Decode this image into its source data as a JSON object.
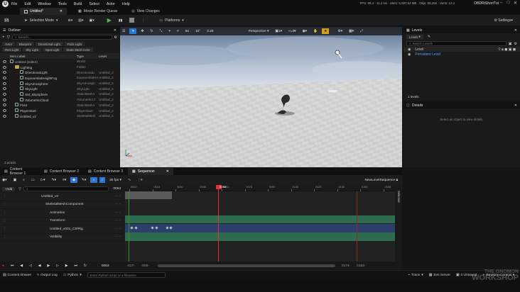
{
  "menubar": {
    "logo": "U",
    "items": [
      "File",
      "Edit",
      "Window",
      "Tools",
      "Build",
      "Select",
      "Actor",
      "Help"
    ],
    "stats": "FPS: 89.4  ·  11.2 ms  ·  Mem: 5,587.64 MB  ·  Objs: 58,255  ·  Verts: 13.4",
    "project": "OBDRtShortTut"
  },
  "tabs": {
    "level_tab": "Untitled*",
    "movie_render_queue": "Movie Render Queue",
    "view_changes": "View Changes"
  },
  "toolbar": {
    "selection_mode": "Selection Mode",
    "platforms": "Platforms"
  },
  "outliner": {
    "title": "Outliner",
    "search_placeholder": "Search...",
    "filters_row1": [
      "Actor",
      "Blueprint",
      "Directional Light",
      "Point Light"
    ],
    "filters_row2": [
      "Rect Light",
      "Sky Light",
      "Spot Light",
      "Static Mesh Actor"
    ],
    "col_item": "Item Label",
    "col_type": "Type",
    "col_level": "Level",
    "rows": [
      {
        "name": "Untitled (Editor)",
        "type": "World",
        "level": "",
        "indent": 0,
        "icon": "world"
      },
      {
        "name": "Lighting",
        "type": "Folder",
        "level": "",
        "indent": 1,
        "icon": "folder"
      },
      {
        "name": "DirectionalLight",
        "type": "DirectionalLi",
        "level": "Untitled_2",
        "indent": 2,
        "icon": "light"
      },
      {
        "name": "ExponentialHeightFog",
        "type": "ExponentialHe",
        "level": "Untitled_2",
        "indent": 2,
        "icon": "fog"
      },
      {
        "name": "SkyAtmosphere",
        "type": "SkyAtmosph",
        "level": "Untitled_2",
        "indent": 2,
        "icon": "sky"
      },
      {
        "name": "SkyLight",
        "type": "SkyLight",
        "level": "Untitled_2",
        "indent": 2,
        "icon": "light"
      },
      {
        "name": "SM_SkySphere",
        "type": "StaticMeshA",
        "level": "Untitled_2",
        "indent": 2,
        "icon": "mesh"
      },
      {
        "name": "VolumetricCloud",
        "type": "VolumetricCl",
        "level": "Untitled_2",
        "indent": 2,
        "icon": "cloud"
      },
      {
        "name": "Floor",
        "type": "StaticMeshA",
        "level": "Untitled_2",
        "indent": 1,
        "icon": "mesh"
      },
      {
        "name": "PlayerStart",
        "type": "PlayerStart",
        "level": "Untitled_2",
        "indent": 1,
        "icon": "player"
      },
      {
        "name": "Untitled_v2",
        "type": "SkeletalMesl",
        "level": "Untitled_2",
        "indent": 1,
        "icon": "mesh"
      }
    ],
    "actor_count": "3 actors"
  },
  "viewport": {
    "perspective": "Perspective",
    "lit": "Lit",
    "grid_snap": "50",
    "rot_snap": "10°",
    "scale_snap": "0.25",
    "cam_speed": "1"
  },
  "levels": {
    "title": "Levels",
    "dropdown": "Levels",
    "search_placeholder": "Search Levels",
    "col_level": "Level",
    "persistent": "Persistent Level",
    "count": "1 levels"
  },
  "details": {
    "title": "Details",
    "empty": "Select an object to view details."
  },
  "sequencer": {
    "tabs": [
      "Content Browser 1",
      "Content Browser 2",
      "Content Browser 3",
      "Sequencer"
    ],
    "fps": "30 fps",
    "sequence_name": "NewLevelSequence",
    "add": "+Add",
    "search_placeholder": "Search Tracks",
    "tracks": [
      {
        "name": "Untitled_v2",
        "indent": 0
      },
      {
        "name": "SkeletalMeshComponent",
        "indent": 1
      },
      {
        "name": "Animation",
        "indent": 2
      },
      {
        "name": "Transform",
        "indent": 2
      },
      {
        "name": "Untitled_v001_CtrlRig",
        "indent": 2
      },
      {
        "name": "Visibility",
        "indent": 2
      }
    ],
    "current_frame": "0053",
    "frame_field": "0053",
    "ruler_ticks": [
      "0000",
      "0015",
      "0030",
      "0045",
      "0060",
      "0075",
      "0090",
      "0105",
      "0120",
      "0135",
      "0150",
      "0165"
    ],
    "range_start": "-017-",
    "range_start2": "-000-",
    "range_end": "0174-",
    "range_end2": "0153-",
    "selection": "Selection"
  },
  "status": {
    "content_drawer": "Content Drawer",
    "output_log": "Output Log",
    "python": "Python",
    "cmd_placeholder": "Enter Python script or a filename",
    "trace": "Trace",
    "zen": "Zen Server",
    "unsaved": "2 Unsaved",
    "revision": "Revision Control"
  },
  "watermark": {
    "line1": "THE GNOMON",
    "line2": "WORKSHOP"
  },
  "colors": {
    "accent_blue": "#2a78d4",
    "play_green": "#4cc04c",
    "playhead_red": "#e0303a",
    "track_green": "#2f6b4f",
    "track_blue": "#2a3f6a"
  }
}
